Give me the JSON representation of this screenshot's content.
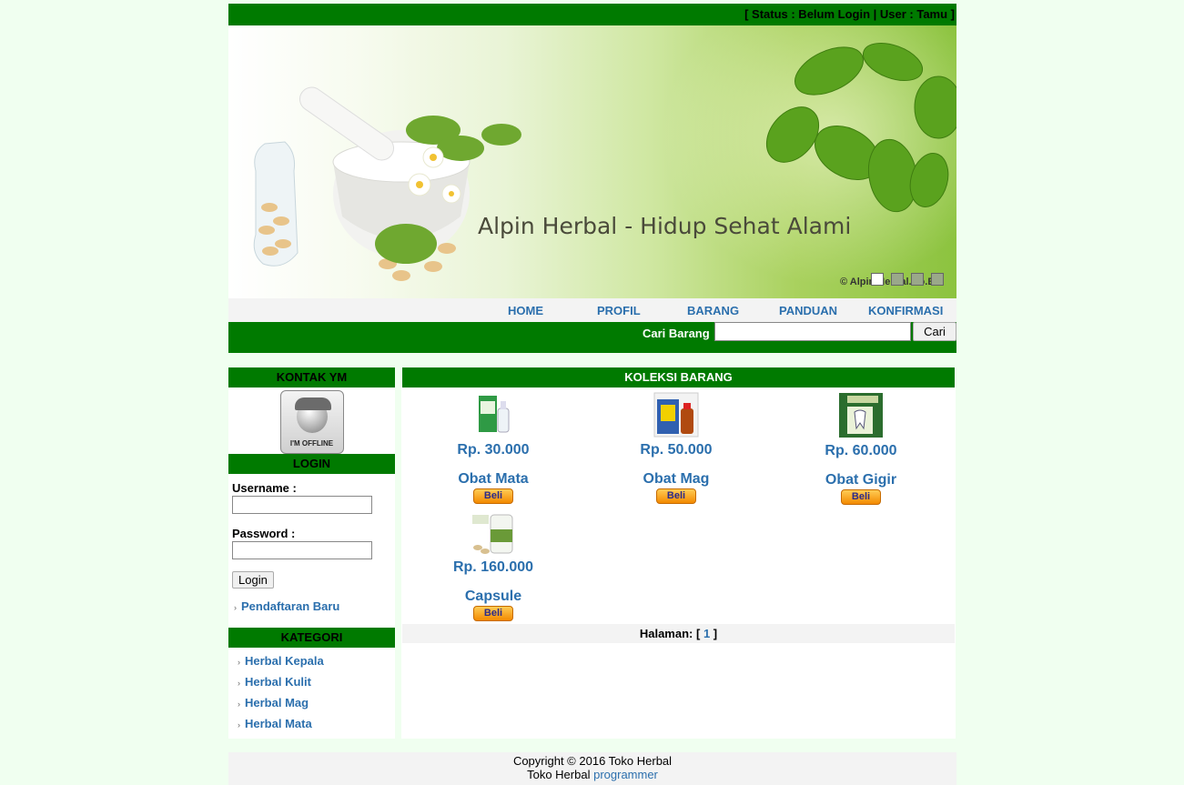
{
  "status": {
    "text": "[ Status : Belum Login | User : Tamu ]"
  },
  "banner": {
    "title": "Alpin Herbal - Hidup Sehat Alami",
    "copyright": "© Alpin Herbal.Ho.Es"
  },
  "menu": [
    "HOME",
    "PROFIL",
    "BARANG",
    "PANDUAN",
    "KONFIRMASI"
  ],
  "search": {
    "label": "Cari Barang",
    "value": "",
    "button": "Cari"
  },
  "sidebar": {
    "ym_header": "KONTAK YM",
    "ym_status": "I'M OFFLINE",
    "login_header": "LOGIN",
    "username_label": "Username :",
    "password_label": "Password :",
    "login_button": "Login",
    "register_link": "Pendaftaran Baru",
    "category_header": "KATEGORI",
    "categories": [
      "Herbal Kepala",
      "Herbal Kulit",
      "Herbal Mag",
      "Herbal Mata"
    ]
  },
  "main": {
    "header": "KOLEKSI BARANG",
    "buy_label": "Beli",
    "products": [
      {
        "name": "Obat Mata",
        "price": "Rp. 30.000"
      },
      {
        "name": "Obat Mag",
        "price": "Rp. 50.000"
      },
      {
        "name": "Obat Gigir",
        "price": "Rp. 60.000"
      },
      {
        "name": "Capsule",
        "price": "Rp. 160.000"
      }
    ],
    "pager_label": "Halaman: [",
    "pager_page": "1",
    "pager_close": "]"
  },
  "footer": {
    "line1": "Copyright © 2016 Toko Herbal",
    "line2_text": "Toko Herbal",
    "line2_link": "programmer"
  }
}
